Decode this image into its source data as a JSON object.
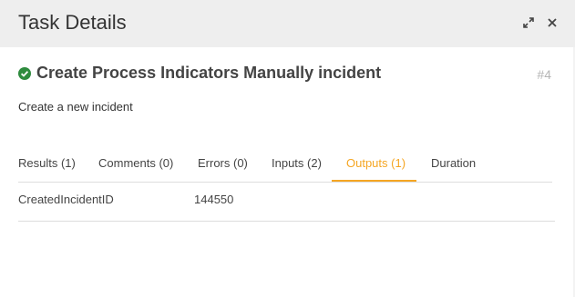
{
  "header": {
    "title": "Task Details",
    "expand_icon": "expand-arrows-icon",
    "close_icon": "close-icon"
  },
  "task": {
    "status_icon": "check-circle-icon",
    "status_color": "#2e8b3e",
    "title": "Create Process Indicators Manually incident",
    "number": "#4",
    "description": "Create a new incident"
  },
  "tabs": [
    {
      "label": "Results (1)",
      "active": false
    },
    {
      "label": "Comments (0)",
      "active": false
    },
    {
      "label": "Errors (0)",
      "active": false
    },
    {
      "label": "Inputs (2)",
      "active": false
    },
    {
      "label": "Outputs (1)",
      "active": true
    },
    {
      "label": "Duration",
      "active": false
    }
  ],
  "outputs": [
    {
      "name": "CreatedIncidentID",
      "value": "144550"
    }
  ],
  "colors": {
    "accent": "#f5a623",
    "header_bg": "#eeeeee"
  }
}
